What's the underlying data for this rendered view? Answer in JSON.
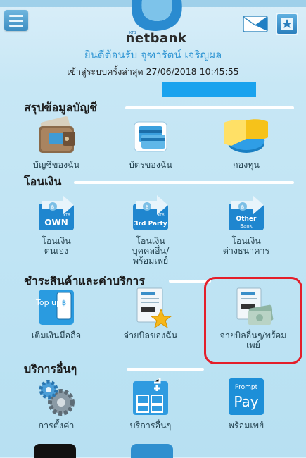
{
  "app": {
    "brand": "netbank",
    "brand_prefix": "KTB",
    "welcome": "ยินดีต้อนรับ จุฑารัตน์ เจริญผล",
    "last_login_label": "เข้าสู่ระบบครั้งล่าสุด",
    "last_login": "27/06/2018 10:45:55"
  },
  "icons": {
    "menu": "menu-icon",
    "mail": "mail-icon",
    "favorite": "star-icon"
  },
  "colors": {
    "accent": "#2f95d3",
    "highlight": "#e41e2a",
    "infobar": "#1aa3ee"
  },
  "sections": [
    {
      "title": "สรุปข้อมูลบัญชี",
      "items": [
        {
          "label": "บัญชีของฉัน",
          "icon": "wallet-icon"
        },
        {
          "label": "บัตรของฉัน",
          "icon": "cards-icon"
        },
        {
          "label": "กองทุน",
          "icon": "pie-chart-icon"
        }
      ]
    },
    {
      "title": "โอนเงิน",
      "items": [
        {
          "label": "โอนเงิน\nตนเอง",
          "icon_text": "OWN",
          "icon_sub": "KTB",
          "icon": "transfer-own-icon"
        },
        {
          "label": "โอนเงิน\nบุคคลอื่น/\nพร้อมเพย์",
          "icon_text": "3rd Party",
          "icon_sub": "KTB",
          "icon": "transfer-third-party-icon"
        },
        {
          "label": "โอนเงิน\nต่างธนาคาร",
          "icon_text": "Other",
          "icon_sub": "Bank",
          "icon": "transfer-other-bank-icon"
        }
      ]
    },
    {
      "title": "ชำระสินค้าและค่าบริการ",
      "items": [
        {
          "label": "เติมเงินมือถือ",
          "icon_text": "Top up",
          "icon": "topup-icon"
        },
        {
          "label": "จ่ายบิลของฉัน",
          "icon": "my-bill-icon"
        },
        {
          "label": "จ่ายบิลอื่นๆ/พร้อม\nเพย์",
          "icon": "other-bill-icon"
        }
      ]
    },
    {
      "title": "บริการอื่นๆ",
      "items": [
        {
          "label": "การตั้งค่า",
          "icon": "settings-gears-icon"
        },
        {
          "label": "บริการอื่นๆ",
          "icon": "more-services-icon"
        },
        {
          "label": "พร้อมเพย์",
          "icon_text": "Prompt",
          "icon_sub": "Pay",
          "icon": "promptpay-icon"
        }
      ]
    }
  ]
}
